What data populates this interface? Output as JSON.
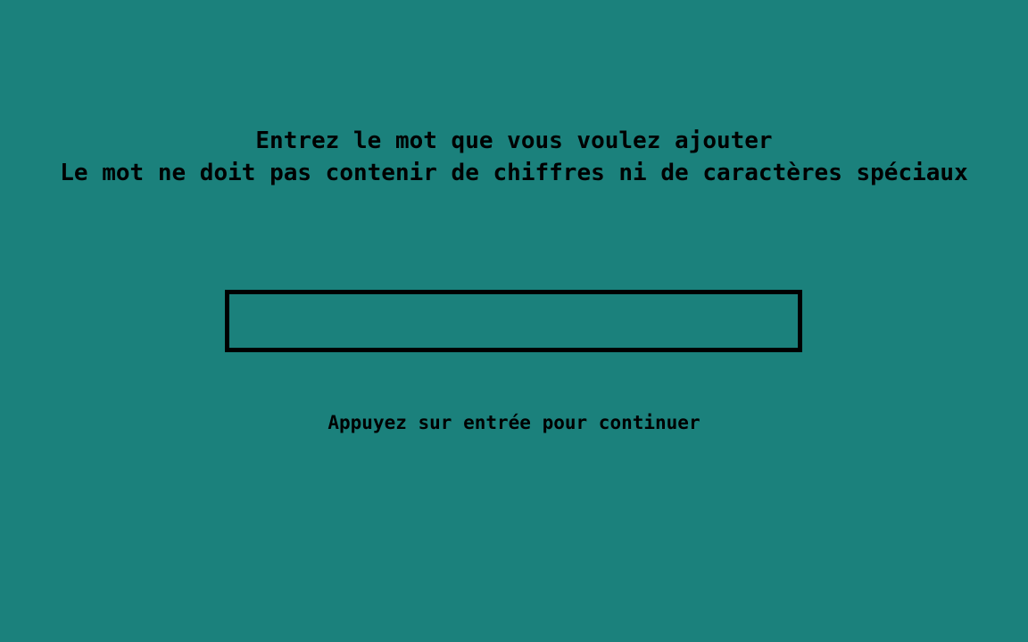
{
  "prompt": {
    "line1": "Entrez le mot que vous voulez ajouter",
    "line2": "Le mot ne doit pas contenir de chiffres ni de caractères spéciaux"
  },
  "word_input": {
    "value": ""
  },
  "hint": {
    "text": "Appuyez sur entrée pour continuer"
  },
  "colors": {
    "background": "#1b817c",
    "text": "#000000",
    "border": "#000000"
  }
}
